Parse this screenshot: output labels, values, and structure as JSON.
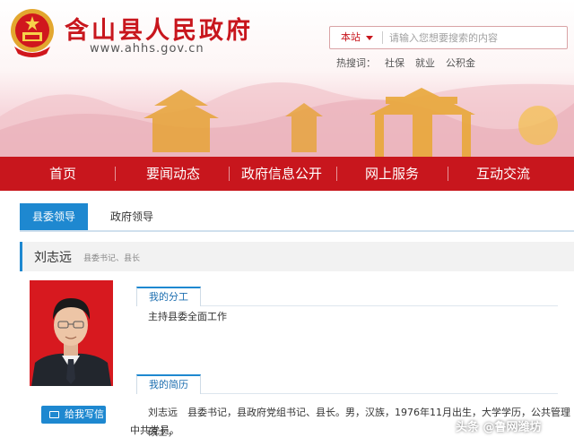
{
  "site": {
    "title": "含山县人民政府",
    "url": "www.ahhs.gov.cn"
  },
  "search": {
    "scope": "本站",
    "placeholder": "请输入您想要搜索的内容"
  },
  "hotwords": {
    "label": "热搜词：",
    "items": [
      "社保",
      "就业",
      "公积金"
    ]
  },
  "nav": {
    "items": [
      "首页",
      "要闻动态",
      "政府信息公开",
      "网上服务",
      "互动交流"
    ]
  },
  "tabs": {
    "items": [
      "县委领导",
      "政府领导"
    ]
  },
  "leader": {
    "name": "刘志远",
    "title": "县委书记、县长"
  },
  "sections": {
    "duty": {
      "heading": "我的分工",
      "text": "主持县委全面工作"
    },
    "resume": {
      "heading": "我的简历",
      "line1": "刘志远　县委书记，县政府党组书记、县长。男，汉族，1976年11月出生，大学学历，公共管理硕士，",
      "line2": "中共党员。"
    }
  },
  "actions": {
    "write_letter": "给我写信"
  },
  "watermark": "头条 @鲁网潍坊",
  "colors": {
    "brand_red": "#c8161d",
    "accent_blue": "#1e88d0"
  }
}
